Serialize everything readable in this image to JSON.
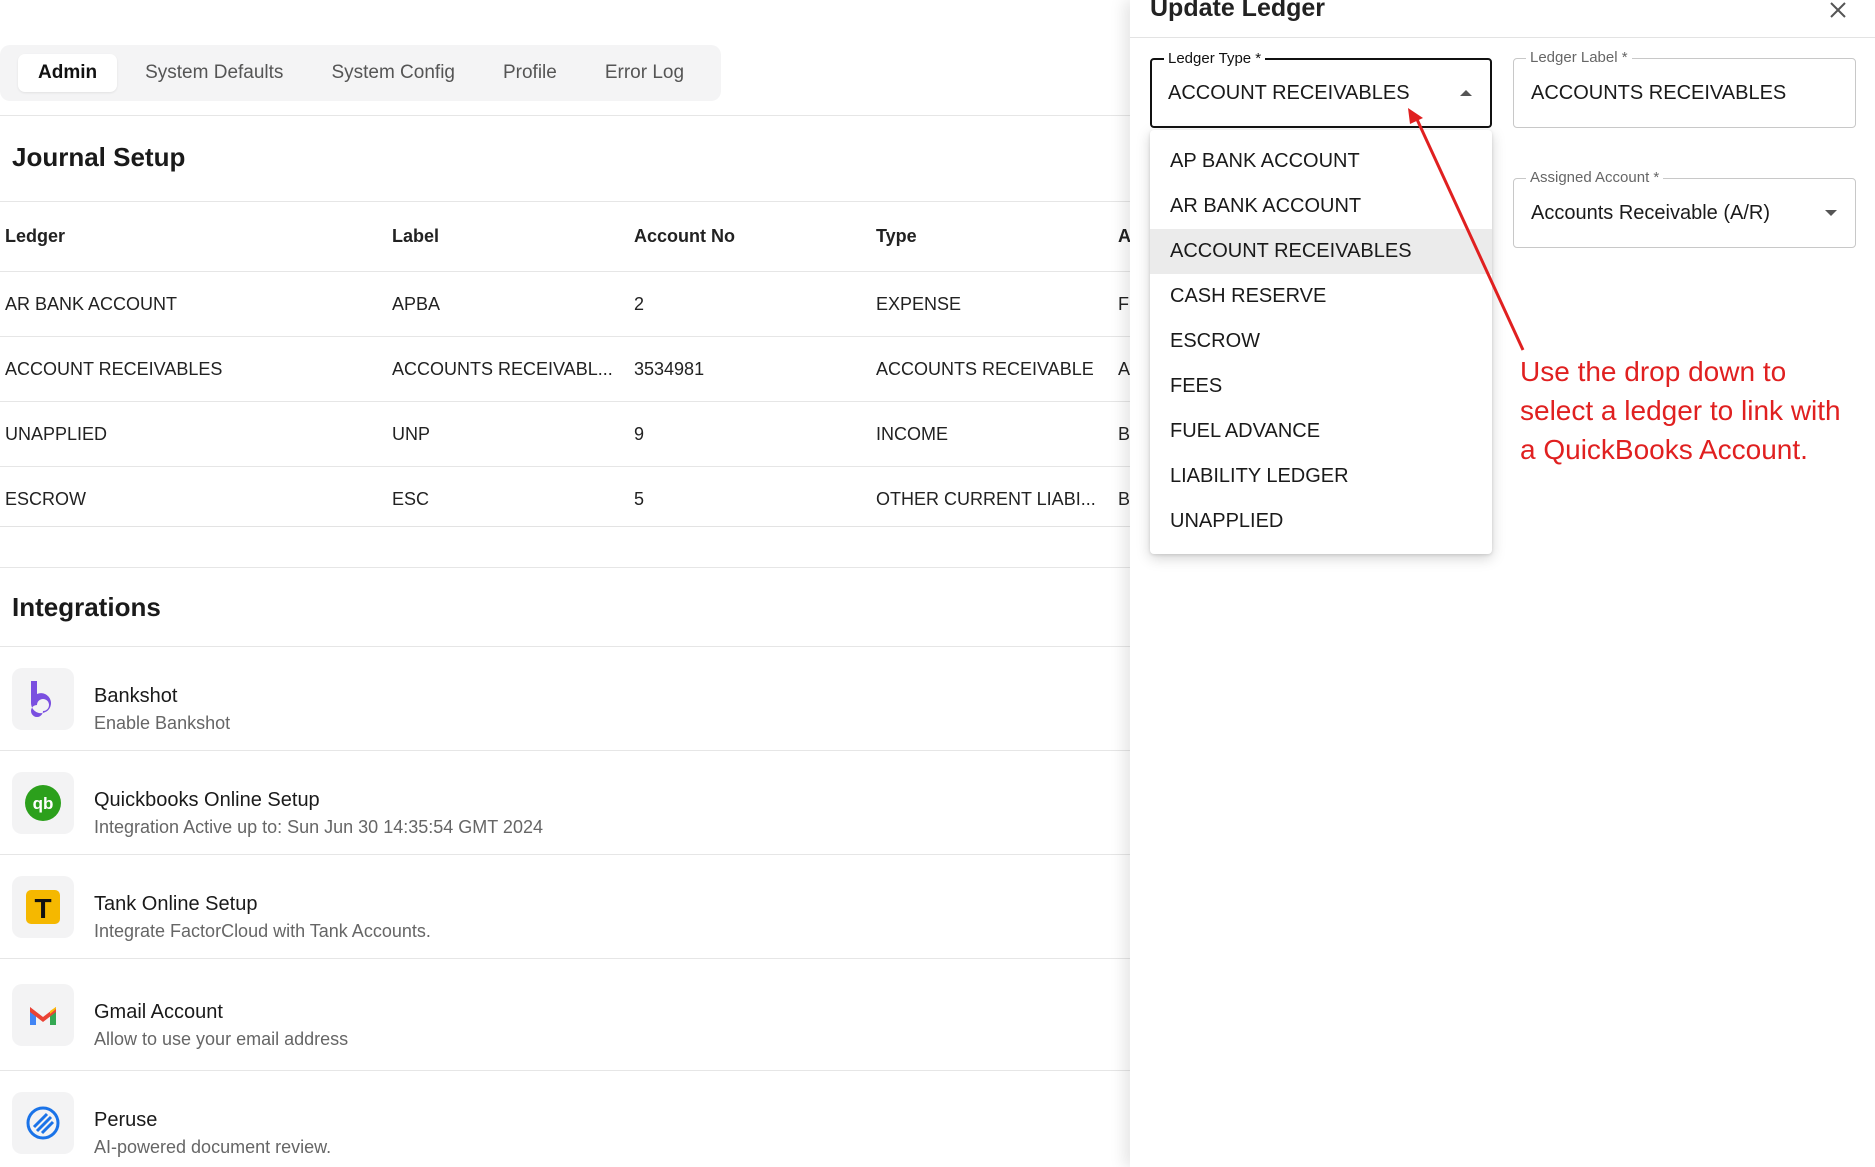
{
  "tabs": [
    {
      "label": "Admin",
      "active": true
    },
    {
      "label": "System Defaults",
      "active": false
    },
    {
      "label": "System Config",
      "active": false
    },
    {
      "label": "Profile",
      "active": false
    },
    {
      "label": "Error Log",
      "active": false
    }
  ],
  "journal": {
    "title": "Journal Setup",
    "columns": [
      "Ledger",
      "Label",
      "Account No",
      "Type",
      "A"
    ],
    "rows": [
      [
        "AR BANK ACCOUNT",
        "APBA",
        "2",
        "EXPENSE",
        "F"
      ],
      [
        "ACCOUNT RECEIVABLES",
        "ACCOUNTS RECEIVABL...",
        "3534981",
        "ACCOUNTS RECEIVABLE",
        "A"
      ],
      [
        "UNAPPLIED",
        "UNP",
        "9",
        "INCOME",
        "B"
      ],
      [
        "ESCROW",
        "ESC",
        "5",
        "OTHER CURRENT LIABI...",
        "B"
      ]
    ]
  },
  "integrations": {
    "title": "Integrations",
    "items": [
      {
        "name": "Bankshot",
        "description": "Enable Bankshot",
        "icon": "bankshot-icon"
      },
      {
        "name": "Quickbooks Online Setup",
        "description": "Integration Active up to: Sun Jun 30 14:35:54 GMT 2024",
        "icon": "quickbooks-icon"
      },
      {
        "name": "Tank Online Setup",
        "description": "Integrate FactorCloud with Tank Accounts.",
        "icon": "tank-icon"
      },
      {
        "name": "Gmail Account",
        "description": "Allow to use your email address",
        "icon": "gmail-icon"
      },
      {
        "name": "Peruse",
        "description": "AI-powered document review.",
        "icon": "peruse-icon"
      }
    ]
  },
  "drawer": {
    "title": "Update Ledger",
    "ledger_type": {
      "label": "Ledger Type *",
      "value": "ACCOUNT RECEIVABLES"
    },
    "ledger_label": {
      "label": "Ledger Label *",
      "value": "ACCOUNTS RECEIVABLES"
    },
    "assigned_account": {
      "label": "Assigned Account *",
      "value": "Accounts Receivable (A/R)"
    },
    "options": [
      "AP BANK ACCOUNT",
      "AR BANK ACCOUNT",
      "ACCOUNT RECEIVABLES",
      "CASH RESERVE",
      "ESCROW",
      "FEES",
      "FUEL ADVANCE",
      "LIABILITY LEDGER",
      "UNAPPLIED"
    ],
    "selected_option": "ACCOUNT RECEIVABLES"
  },
  "annotation": {
    "lines": [
      "Use the drop down to",
      "select a ledger to link with",
      "a QuickBooks Account."
    ],
    "color": "#e02020"
  },
  "colors": {
    "bankshot": "#7a4fe0",
    "quickbooks": "#2ca01c",
    "tank": "#f5b800",
    "peruse": "#1a73e8"
  }
}
